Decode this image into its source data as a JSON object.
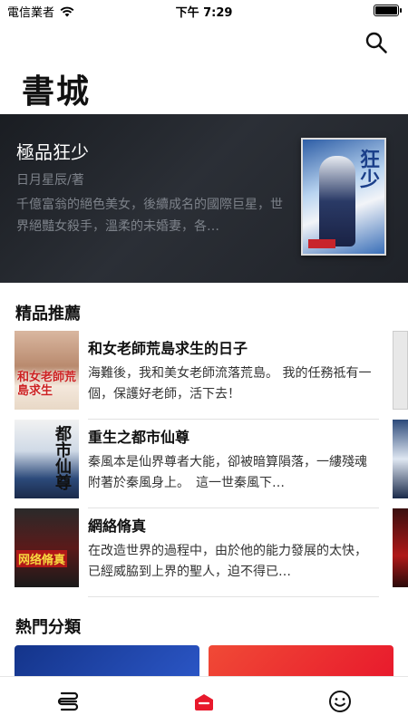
{
  "status_bar": {
    "carrier": "電信業者",
    "time": "下午 7:29"
  },
  "header": {
    "title": "書城",
    "search_icon": "search-icon"
  },
  "featured": {
    "title": "極品狂少",
    "author": "日月星辰/著",
    "description": "千億富翁的絕色美女，後續成名的國際巨星，世界絕豔女殺手，溫柔的未婚妻，各…",
    "cover_title": "狂少"
  },
  "recommend": {
    "heading": "精品推薦",
    "items": [
      {
        "title": "和女老師荒島求生的日子",
        "description": "海難後，我和美女老師流落荒島。 我的任務祗有一個，保護好老師，活下去！",
        "cover_text": "和女老師荒島求生"
      },
      {
        "title": "重生之都市仙尊",
        "description": "秦風本是仙界尊者大能，卻被暗算隕落，一縷殘魂附著於秦風身上。　這一世秦風下…",
        "cover_text": "都市仙尊"
      },
      {
        "title": "網絡脩真",
        "description": "在改造世界的過程中，由於他的能力發展的太快，已經威脇到上界的聖人，迫不得已…",
        "cover_text": "网络脩真"
      }
    ]
  },
  "categories": {
    "heading": "熱門分類"
  },
  "tab_bar": {
    "tabs": [
      {
        "icon": "bookshelf-icon",
        "active": false
      },
      {
        "icon": "bookstore-icon",
        "active": true,
        "color": "#e8192c"
      },
      {
        "icon": "profile-smiley-icon",
        "active": false
      }
    ]
  }
}
